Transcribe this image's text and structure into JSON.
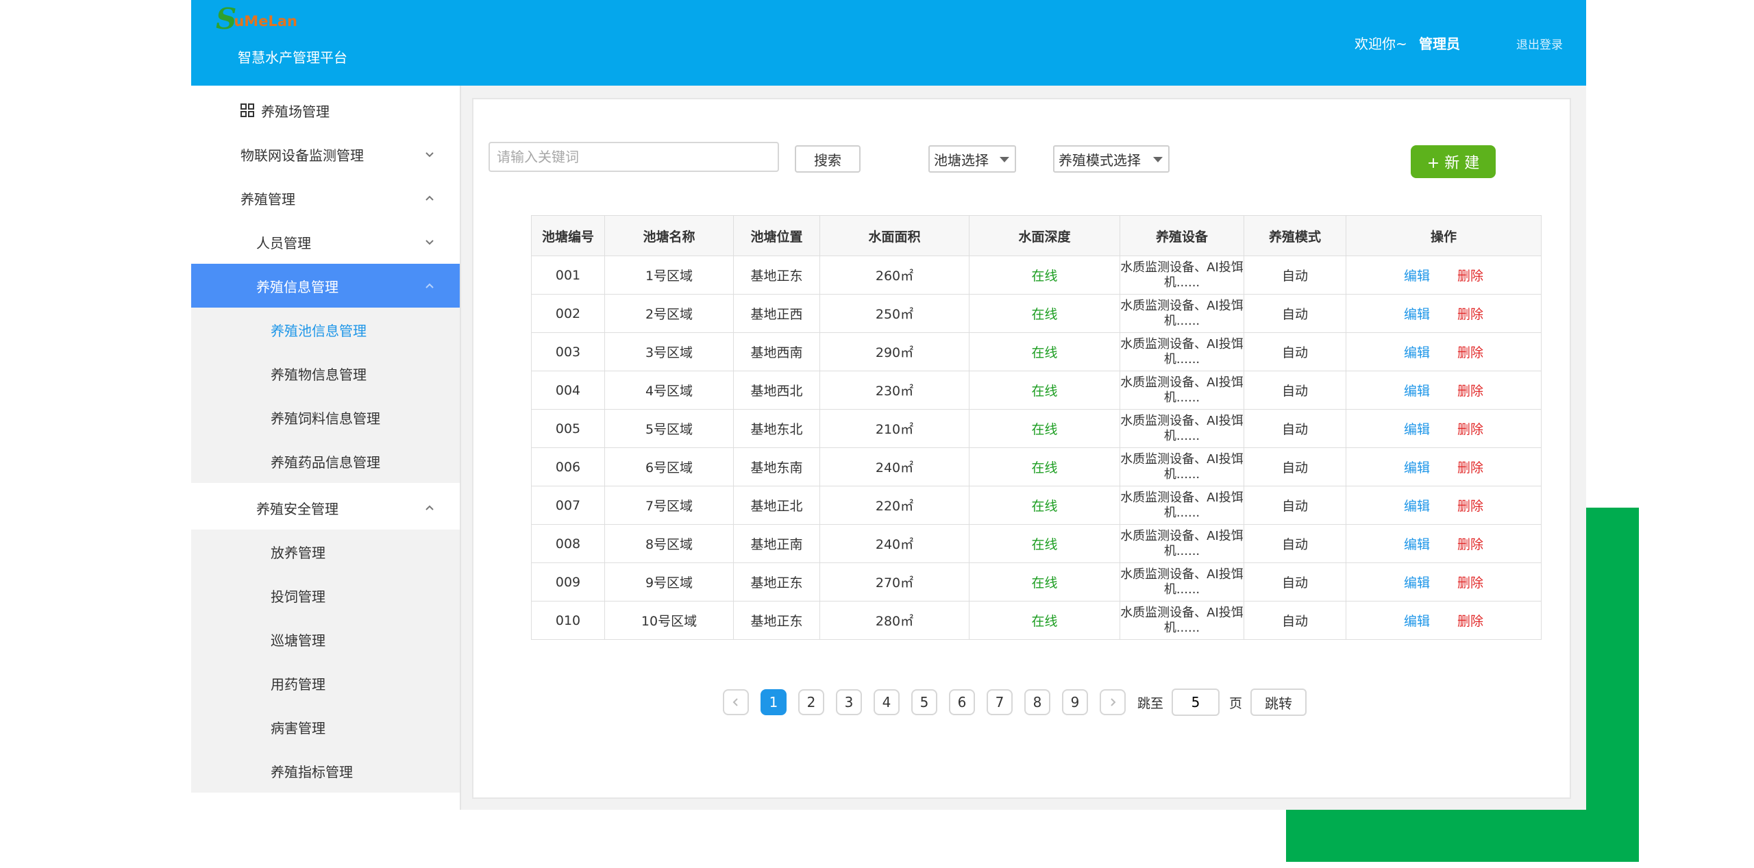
{
  "header": {
    "logo_text": "uMeLan",
    "platform_name": "智慧水产管理平台",
    "welcome": "欢迎你~",
    "user": "管理员",
    "logout": "退出登录"
  },
  "sidebar": {
    "top": "养殖场管理",
    "items": [
      "物联网设备监测管理",
      "养殖管理",
      "人员管理",
      "养殖信息管理",
      "养殖池信息管理",
      "养殖物信息管理",
      "养殖饲料信息管理",
      "养殖药品信息管理",
      "养殖安全管理",
      "放养管理",
      "投饲管理",
      "巡塘管理",
      "用药管理",
      "病害管理",
      "养殖指标管理"
    ]
  },
  "toolbar": {
    "search_placeholder": "请输入关键词",
    "search_label": "搜索",
    "pond_select": "池塘选择",
    "mode_select": "养殖模式选择",
    "new_label": "+ 新 建"
  },
  "table": {
    "headers": [
      "池塘编号",
      "池塘名称",
      "池塘位置",
      "水面面积",
      "水面深度",
      "养殖设备",
      "养殖模式",
      "操作"
    ],
    "rows": [
      [
        "001",
        "1号区域",
        "基地正东",
        "260㎡",
        "在线",
        "水质监测设备、AI投饵机......",
        "自动"
      ],
      [
        "002",
        "2号区域",
        "基地正西",
        "250㎡",
        "在线",
        "水质监测设备、AI投饵机......",
        "自动"
      ],
      [
        "003",
        "3号区域",
        "基地西南",
        "290㎡",
        "在线",
        "水质监测设备、AI投饵机......",
        "自动"
      ],
      [
        "004",
        "4号区域",
        "基地西北",
        "230㎡",
        "在线",
        "水质监测设备、AI投饵机......",
        "自动"
      ],
      [
        "005",
        "5号区域",
        "基地东北",
        "210㎡",
        "在线",
        "水质监测设备、AI投饵机......",
        "自动"
      ],
      [
        "006",
        "6号区域",
        "基地东南",
        "240㎡",
        "在线",
        "水质监测设备、AI投饵机......",
        "自动"
      ],
      [
        "007",
        "7号区域",
        "基地正北",
        "220㎡",
        "在线",
        "水质监测设备、AI投饵机......",
        "自动"
      ],
      [
        "008",
        "8号区域",
        "基地正南",
        "240㎡",
        "在线",
        "水质监测设备、AI投饵机......",
        "自动"
      ],
      [
        "009",
        "9号区域",
        "基地正东",
        "270㎡",
        "在线",
        "水质监测设备、AI投饵机......",
        "自动"
      ],
      [
        "010",
        "10号区域",
        "基地正东",
        "280㎡",
        "在线",
        "水质监测设备、AI投饵机......",
        "自动"
      ]
    ],
    "edit_label": "编辑",
    "delete_label": "删除"
  },
  "pagination": {
    "pages": [
      "1",
      "2",
      "3",
      "4",
      "5",
      "6",
      "7",
      "8",
      "9"
    ],
    "current": "1",
    "jump_prefix": "跳至",
    "jump_value": "5",
    "jump_suffix": "页",
    "jump_button": "跳转"
  },
  "colors": {
    "header_bg": "#05a7ec",
    "active_menu": "#4a8ff7",
    "new_button": "#5db21c",
    "status_green": "#1d9e22",
    "edit_blue": "#1e96e8",
    "delete_red": "#e12828",
    "deco_green": "#00ac4f"
  }
}
